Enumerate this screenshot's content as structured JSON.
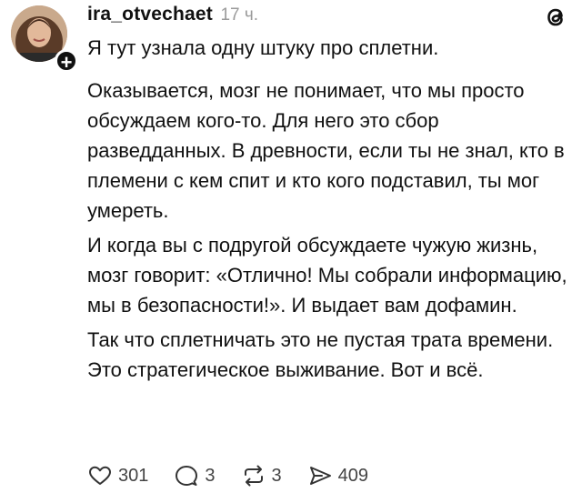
{
  "post": {
    "username": "ira_otvechaet",
    "timestamp": "17 ч.",
    "lines": [
      "Я тут узнала одну штуку про сплетни.",
      "Оказывается, мозг не понимает, что мы просто обсуждаем кого-то. Для него это сбор разведданных. В древности, если ты не знал, кто в племени с кем спит и кто кого подставил, ты мог умереть.",
      "И когда вы с подругой обсуждаете чужую жизнь, мозг говорит: «Отлично! Мы собрали информацию, мы в безопасности!». И выдает вам дофамин.",
      "Так что сплетничать это не пустая трата времени. Это стратегическое выживание. Вот и всё."
    ]
  },
  "actions": {
    "likes": "301",
    "replies": "3",
    "reposts": "3",
    "shares": "409"
  },
  "icons": {
    "avatar": "profile-photo",
    "follow": "plus-icon",
    "brand": "threads-logo-icon",
    "like": "heart-icon",
    "reply": "comment-bubble-icon",
    "repost": "repost-arrows-icon",
    "share": "send-icon"
  }
}
